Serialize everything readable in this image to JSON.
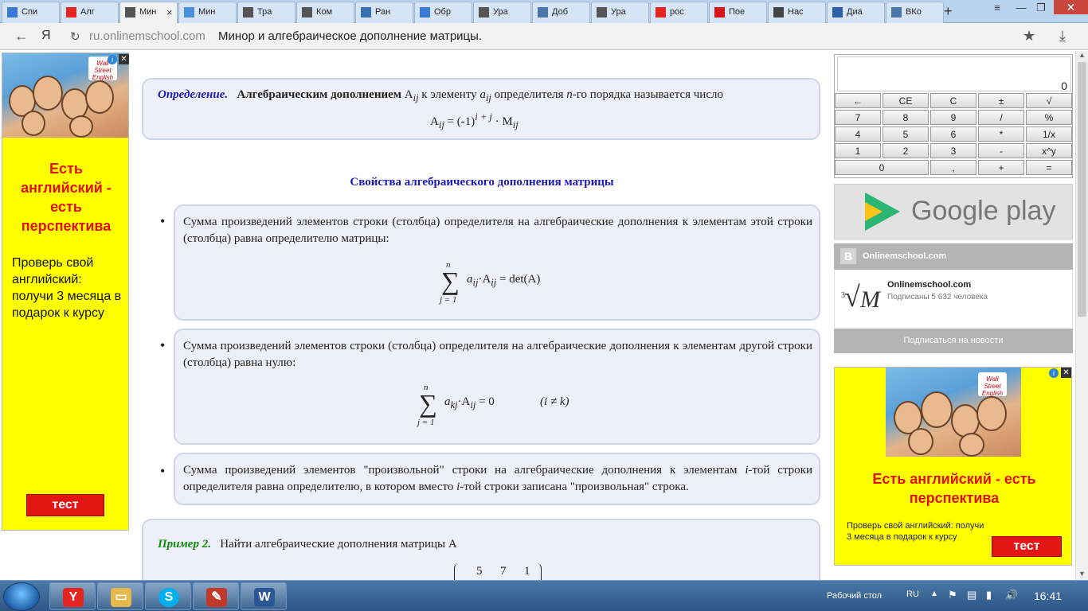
{
  "browser": {
    "tabs": [
      {
        "label": "Спи",
        "icon": "doc-icon",
        "color": "#3a7bd5"
      },
      {
        "label": "Алг",
        "icon": "yandex-icon",
        "color": "#e52620"
      },
      {
        "label": "Мин",
        "icon": "root-icon",
        "color": "#555555",
        "active": true
      },
      {
        "label": "Мин",
        "icon": "folder-icon",
        "color": "#4a90d9"
      },
      {
        "label": "Тра",
        "icon": "root-icon",
        "color": "#555555"
      },
      {
        "label": "Ком",
        "icon": "root-icon",
        "color": "#555555"
      },
      {
        "label": "Ран",
        "icon": "book-icon",
        "color": "#3a6fb0"
      },
      {
        "label": "Обр",
        "icon": "doc-icon",
        "color": "#3a7bd5"
      },
      {
        "label": "Ура",
        "icon": "root-icon",
        "color": "#555555"
      },
      {
        "label": "Доб",
        "icon": "vk-icon",
        "color": "#4a76a8"
      },
      {
        "label": "Ура",
        "icon": "root-icon",
        "color": "#555555"
      },
      {
        "label": "рос",
        "icon": "yandex-icon",
        "color": "#e52620"
      },
      {
        "label": "Пое",
        "icon": "one-icon",
        "color": "#d4161c"
      },
      {
        "label": "Нас",
        "icon": "gear-icon",
        "color": "#444444"
      },
      {
        "label": "Диа",
        "icon": "play-icon",
        "color": "#2f5fa6"
      },
      {
        "label": "ВКо",
        "icon": "vk-icon",
        "color": "#4a76a8"
      }
    ],
    "url": "ru.onlinemschool.com",
    "page_title": "Минор и алгебраическое дополнение матрицы."
  },
  "left_ad": {
    "brand_line1": "Wall",
    "brand_line2": "Street",
    "brand_line3": "English",
    "headline": "Есть английский - есть перспектива",
    "body": "Проверь свой английский: получи 3 месяца в подарок к курсу",
    "button": "тест"
  },
  "article": {
    "definition": {
      "label": "Определение.",
      "bold_text": "Алгебраическим дополнением",
      "sym_A": "A",
      "sub_ij": "ij",
      "text1": "к элементу",
      "sym_a": "a",
      "text2": "определителя",
      "sym_n": "n",
      "text3": "-го порядка называется число",
      "formula_mid": " = (-1)",
      "formula_exp": "i + j",
      "formula_dot": " · M"
    },
    "properties_title": "Свойства алгебраического дополнения матрицы",
    "property1": {
      "text": "Сумма произведений элементов строки (столбца) определителя на алгебраические дополнения к элементам этой строки (столбца) равна определителю матрицы:",
      "upper": "n",
      "lower": "j = 1",
      "term": "a",
      "sub1": "ij",
      "term2": "·A",
      "sub2": "ij",
      "result": " = det(A)"
    },
    "property2": {
      "text": "Сумма произведений элементов строки (столбца) определителя на алгебраические дополнения к элементам другой строки (столбца) равна нулю:",
      "upper": "n",
      "lower": "j = 1",
      "term": "a",
      "sub1": "kj",
      "term2": "·A",
      "sub2": "ij",
      "result": " = 0",
      "cond": "(i ≠ k)"
    },
    "property3": {
      "t1": "Сумма произведений элементов \"произвольной\" строки на алгебраические дополнения к элементам ",
      "i1": "i",
      "t2": "-той строки определителя равна определителю, в котором вместо ",
      "i2": "i",
      "t3": "-той строки записана \"произвольная\" строка."
    },
    "example": {
      "label": "Пример 2.",
      "text": "Найти алгебраические дополнения матрицы A",
      "row1": [
        "5",
        "7",
        "1"
      ]
    }
  },
  "calculator": {
    "display": "0",
    "keys": [
      [
        "←",
        "CE",
        "C",
        "±",
        "√"
      ],
      [
        "7",
        "8",
        "9",
        "/",
        "%"
      ],
      [
        "4",
        "5",
        "6",
        "*",
        "1/x"
      ],
      [
        "1",
        "2",
        "3",
        "-",
        "x^y"
      ],
      [
        "0",
        ",",
        "+",
        "="
      ]
    ]
  },
  "google_play": {
    "text": "Google play"
  },
  "vk_widget": {
    "header": "Onlinemschool.com",
    "group_name": "Onlinemschool.com",
    "subscribers": "Подписаны 5 632 человека",
    "subscribe": "Подписаться на новости",
    "avatar_letter": "M",
    "avatar_index": "3"
  },
  "right_ad": {
    "brand_line1": "Wall",
    "brand_line2": "Street",
    "brand_line3": "English",
    "headline": "Есть английский - есть перспектива",
    "body": "Проверь свой английский: получи 3 месяца в подарок к курсу",
    "button": "тест"
  },
  "taskbar": {
    "desktop_label": "Рабочий стол",
    "lang": "RU",
    "clock": "16:41"
  }
}
